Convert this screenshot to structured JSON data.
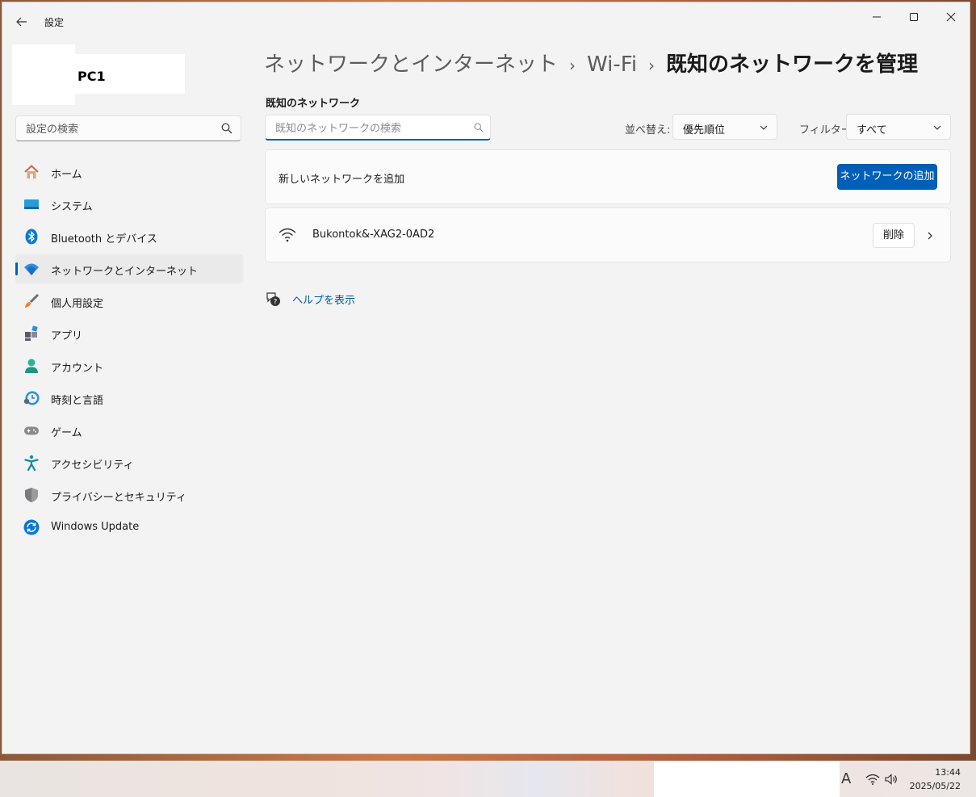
{
  "window": {
    "app_title": "設定"
  },
  "user": {
    "name": "PC1"
  },
  "sidebar": {
    "search_placeholder": "設定の検索",
    "items": [
      {
        "label": "ホーム",
        "icon": "home-icon"
      },
      {
        "label": "システム",
        "icon": "system-icon"
      },
      {
        "label": "Bluetooth とデバイス",
        "icon": "bluetooth-icon"
      },
      {
        "label": "ネットワークとインターネット",
        "icon": "network-icon",
        "selected": true
      },
      {
        "label": "個人用設定",
        "icon": "brush-icon"
      },
      {
        "label": "アプリ",
        "icon": "apps-icon"
      },
      {
        "label": "アカウント",
        "icon": "account-icon"
      },
      {
        "label": "時刻と言語",
        "icon": "time-language-icon"
      },
      {
        "label": "ゲーム",
        "icon": "gamepad-icon"
      },
      {
        "label": "アクセシビリティ",
        "icon": "accessibility-icon"
      },
      {
        "label": "プライバシーとセキュリティ",
        "icon": "shield-icon"
      },
      {
        "label": "Windows Update",
        "icon": "update-icon"
      }
    ]
  },
  "breadcrumb": {
    "part1": "ネットワークとインターネット",
    "part2": "Wi-Fi",
    "current": "既知のネットワークを管理",
    "separator": "›"
  },
  "main": {
    "section_title": "既知のネットワーク",
    "search_placeholder": "既知のネットワークの検索",
    "sort_label": "並べ替え:",
    "sort_value": "優先順位",
    "filter_label": "フィルター:",
    "filter_value": "すべて",
    "add_network_label": "新しいネットワークを追加",
    "add_network_button": "ネットワークの追加",
    "networks": [
      {
        "name": "Bukontok&-XAG2-0AD2",
        "delete_label": "削除"
      }
    ],
    "help_link": "ヘルプを表示"
  },
  "taskbar": {
    "ime": "A",
    "time": "13:44",
    "date": "2025/05/22"
  },
  "colors": {
    "accent": "#005fb8",
    "link": "#005a9e",
    "window_bg": "#f3f3f3"
  }
}
